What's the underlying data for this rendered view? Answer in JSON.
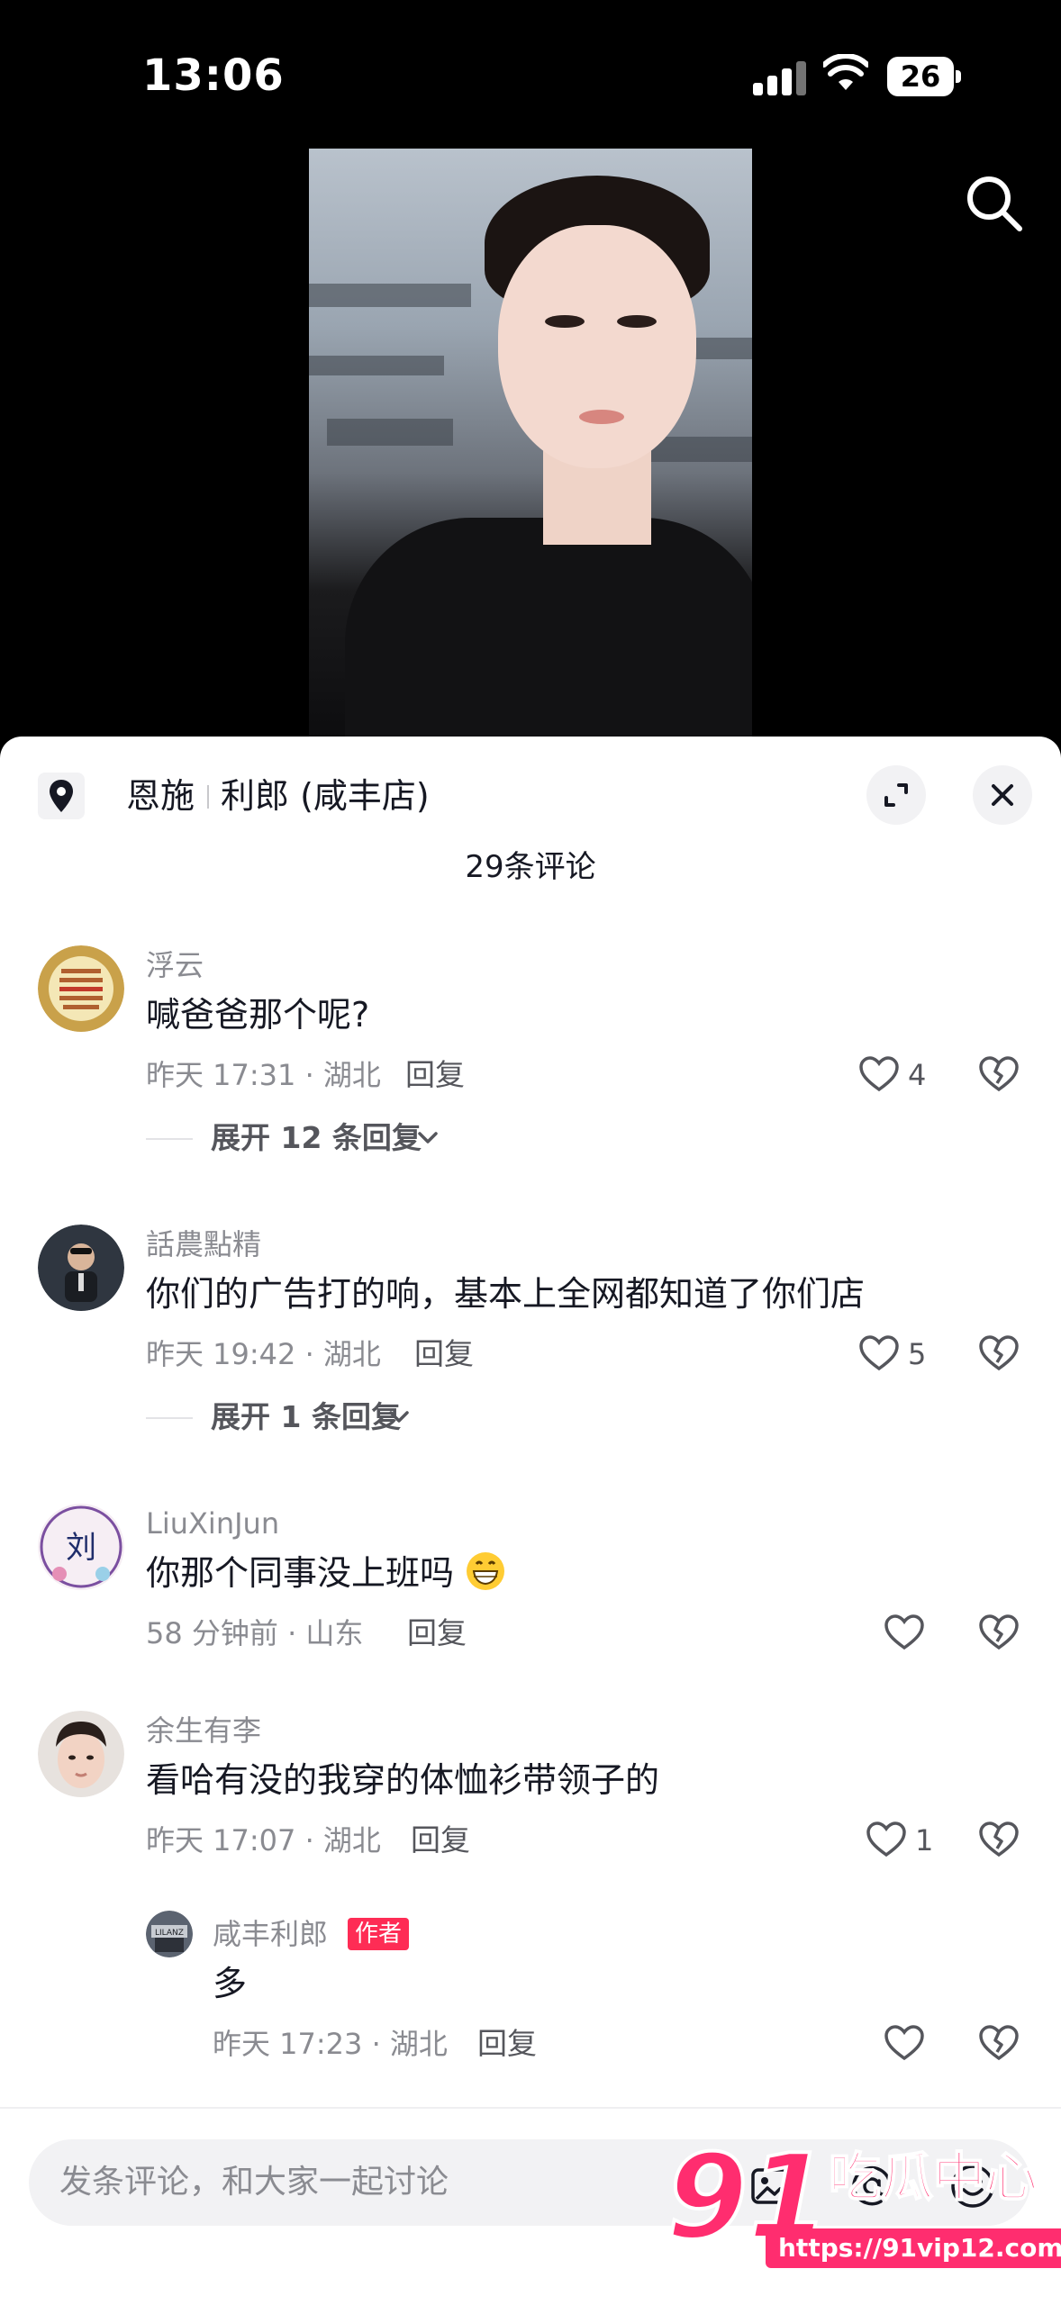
{
  "status_bar": {
    "time": "13:06",
    "battery": "26"
  },
  "sheet": {
    "location_city": "恩施",
    "location_store": "利郎 (咸丰店)",
    "comment_count": "29条评论"
  },
  "comments": [
    {
      "name": "浮云",
      "text": "喊爸爸那个呢?",
      "time": "昨天 17:31 · 湖北",
      "reply": "回复",
      "likes": "4",
      "expand": "展开 12 条回复"
    },
    {
      "name": "話農點精",
      "text": "你们的广告打的响，基本上全网都知道了你们店",
      "time": "昨天 19:42 · 湖北",
      "reply": "回复",
      "likes": "5",
      "expand": "展开 1 条回复"
    },
    {
      "name": "LiuXinJun",
      "text": "你那个同事没上班吗",
      "time": "58 分钟前 · 山东",
      "reply": "回复",
      "likes": ""
    },
    {
      "name": "余生有李",
      "text": "看哈有没的我穿的体恤衫带领子的",
      "time": "昨天 17:07 · 湖北",
      "reply": "回复",
      "likes": "1"
    }
  ],
  "reply": {
    "name": "咸丰利郎",
    "badge": "作者",
    "text": "多",
    "time": "昨天 17:23 · 湖北",
    "reply": "回复"
  },
  "input": {
    "placeholder": "发条评论，和大家一起讨论"
  },
  "watermark": {
    "number": "91",
    "text": "吃瓜中心",
    "url": "https://91vip12.com"
  },
  "colors": {
    "accent": "#fe2c55",
    "meta": "#8a8b91",
    "text": "#161823"
  },
  "icons": [
    "location-pin-icon",
    "search-icon",
    "expand-icon",
    "close-icon",
    "heart-icon",
    "broken-heart-icon",
    "image-icon",
    "at-icon",
    "emoji-icon"
  ]
}
